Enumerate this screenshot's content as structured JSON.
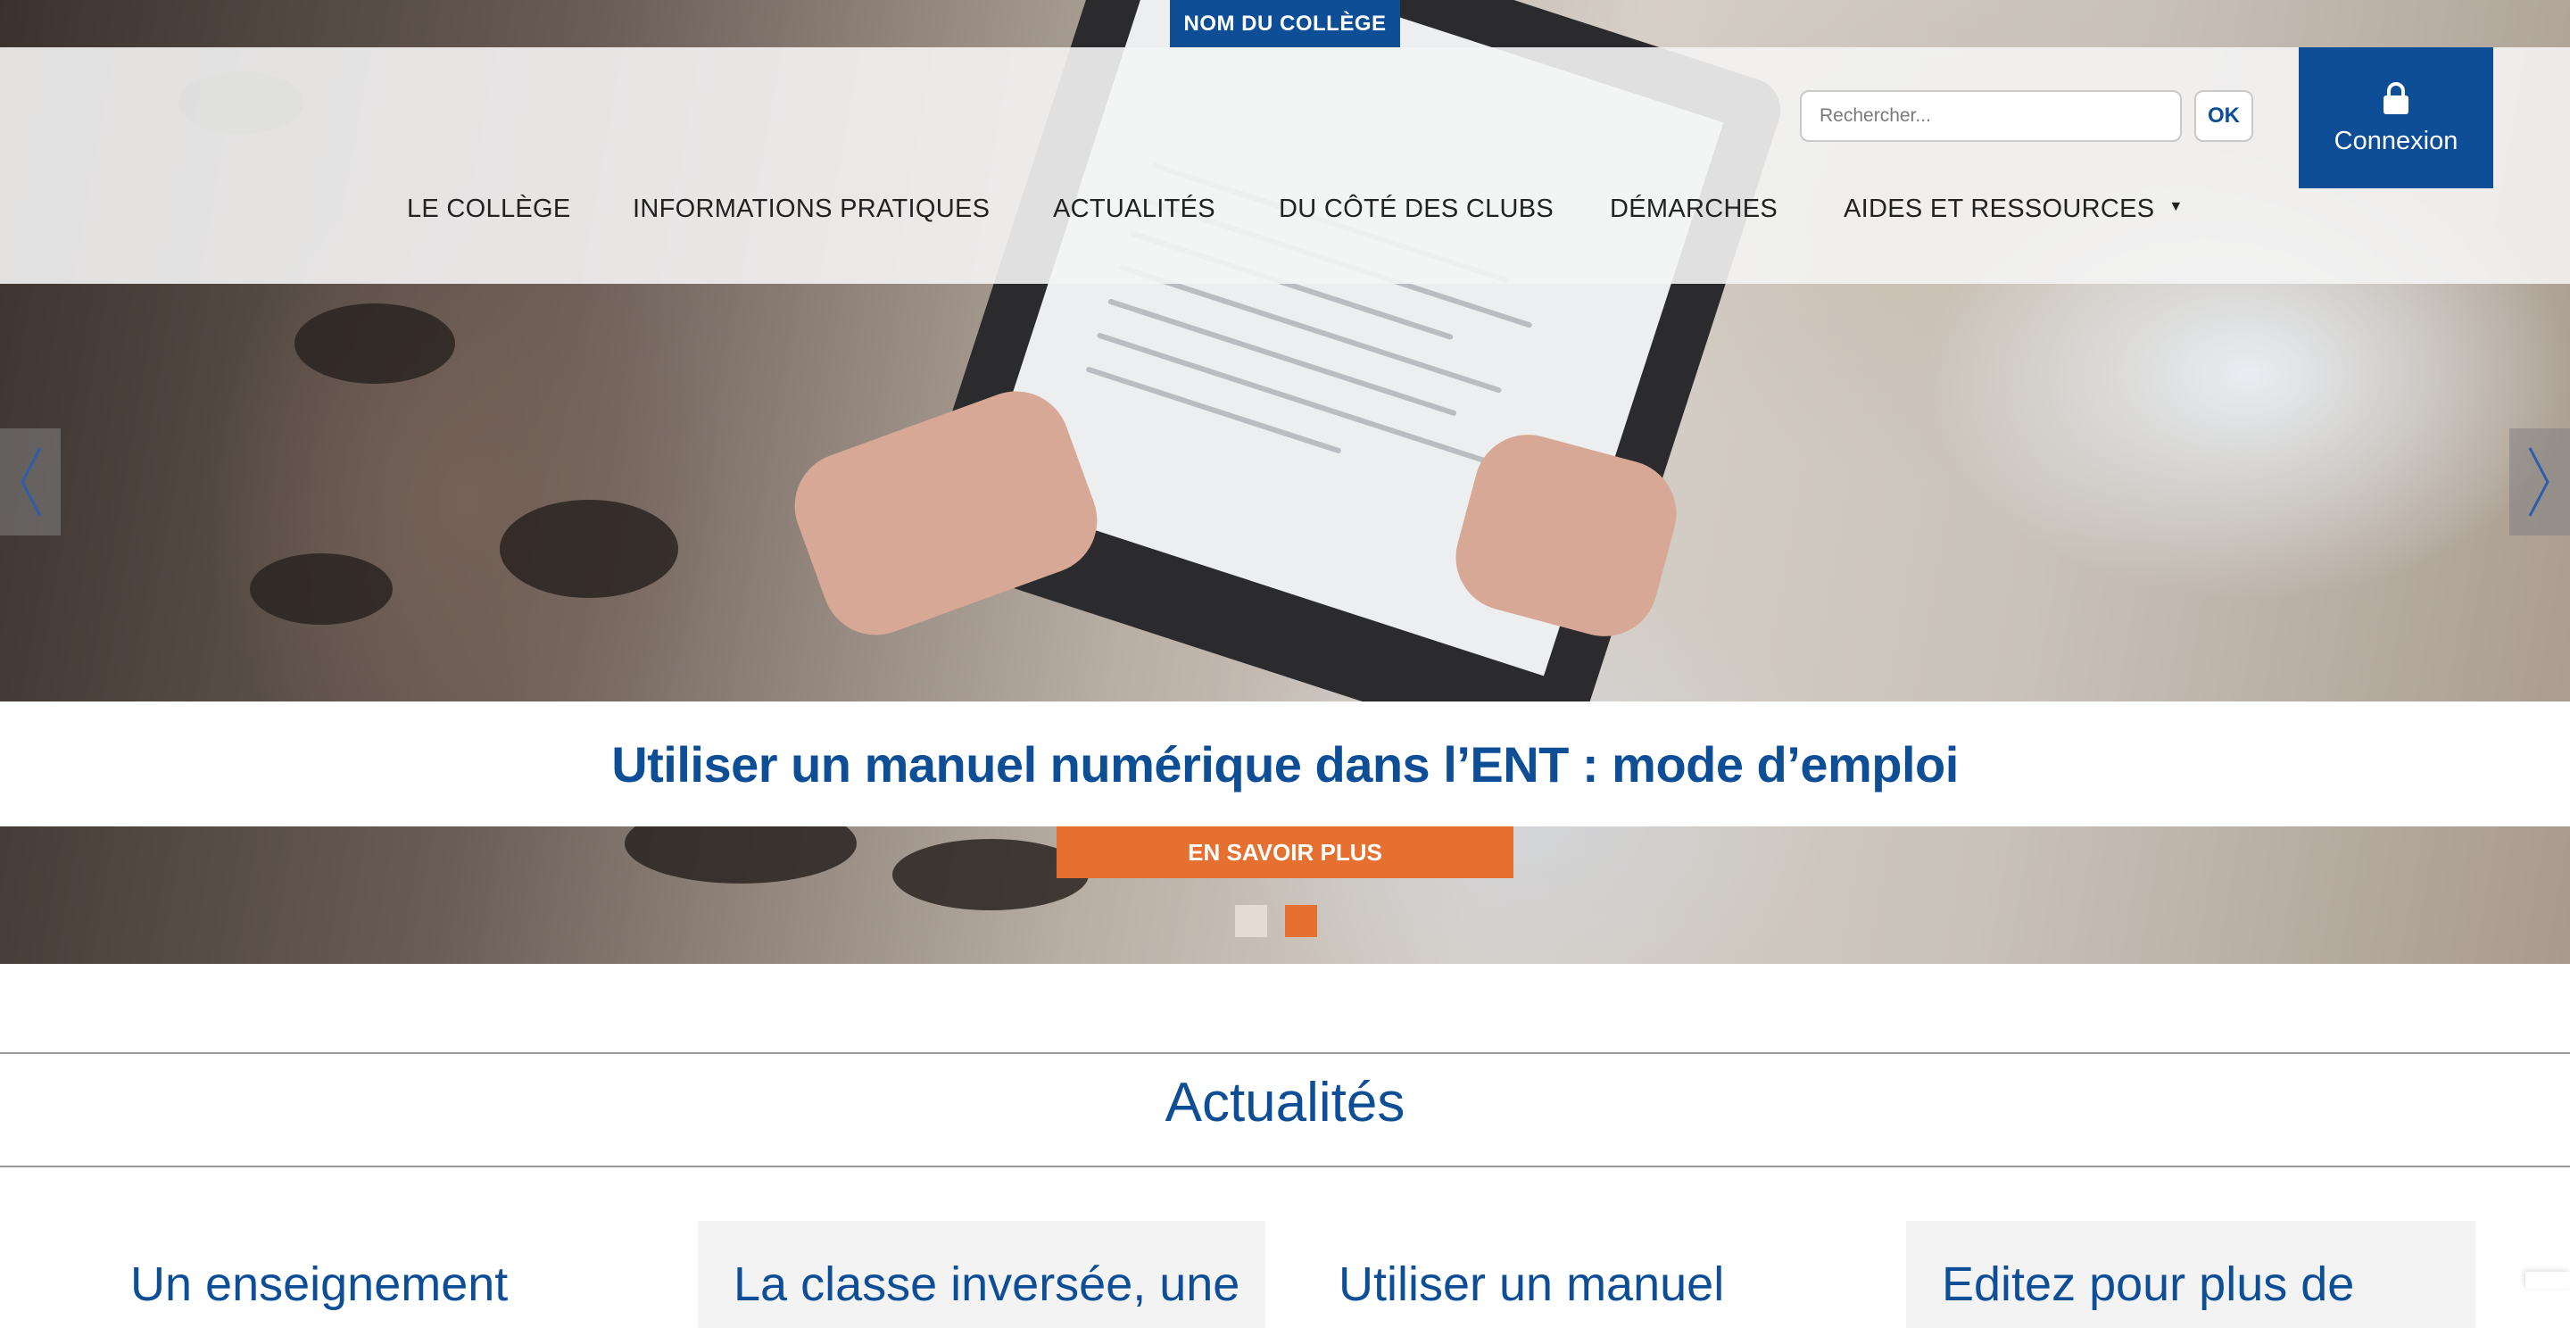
{
  "brand": {
    "college_name": "NOM DU COLLÈGE",
    "primary_color": "#0d4e97",
    "accent_color": "#e5702f"
  },
  "search": {
    "placeholder": "Rechercher...",
    "button_label": "OK"
  },
  "login": {
    "label": "Connexion",
    "icon": "lock-icon"
  },
  "nav": {
    "items": [
      {
        "label": "LE COLLÈGE"
      },
      {
        "label": "INFORMATIONS PRATIQUES"
      },
      {
        "label": "ACTUALITÉS"
      },
      {
        "label": "DU CÔTÉ DES CLUBS"
      },
      {
        "label": "DÉMARCHES"
      },
      {
        "label": "AIDES ET RESSOURCES",
        "has_dropdown": true
      }
    ]
  },
  "carousel": {
    "slide_title": "Utiliser un manuel numérique dans l’ENT : mode d’emploi",
    "cta_label": "EN SAVOIR PLUS",
    "slide_count": 2,
    "active_slide": 2,
    "prev_icon": "chevron-left-icon",
    "next_icon": "chevron-right-icon"
  },
  "news": {
    "section_title": "Actualités",
    "cards": [
      {
        "title": "Un enseignement"
      },
      {
        "title": "La classe inversée, une"
      },
      {
        "title": "Utiliser un manuel"
      },
      {
        "title": "Editez pour plus de"
      }
    ]
  }
}
